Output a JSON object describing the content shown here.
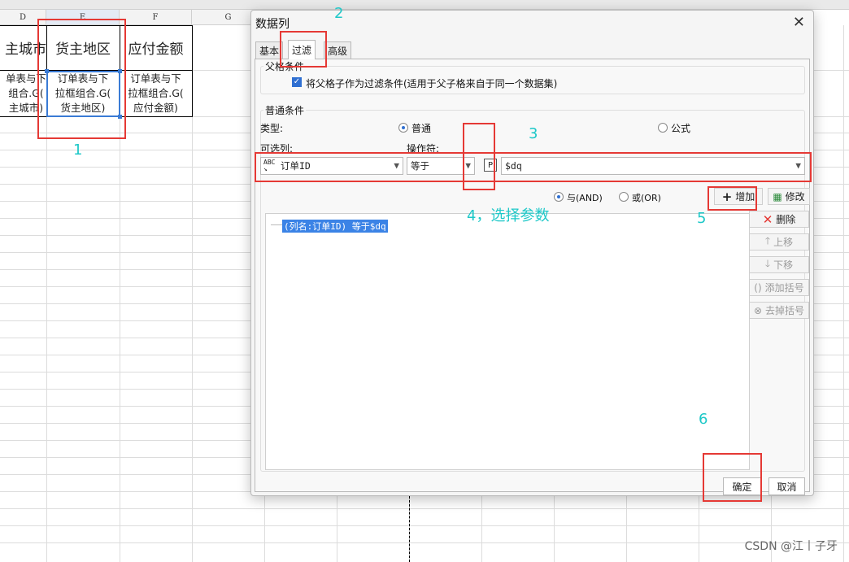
{
  "sheet": {
    "columns": [
      "D",
      "E",
      "F",
      "G"
    ],
    "headers": [
      "主城市",
      "货主地区",
      "应付金额"
    ],
    "cells": [
      "单表与下\n组合.G(\n主城市)",
      "订单表与下\n拉框组合.G(\n货主地区)",
      "订单表与下\n拉框组合.G(\n应付金额)"
    ]
  },
  "dialog": {
    "title": "数据列",
    "close": "✕",
    "tabs": [
      "基本",
      "过滤",
      "高级"
    ],
    "parent_group_title": "父格条件",
    "parent_checkbox_label": "将父格子作为过滤条件(适用于父子格来自于同一个数据集)",
    "normal_group_title": "普通条件",
    "type_label": "类型:",
    "type_options": [
      "普通",
      "公式"
    ],
    "column_label": "可选列:",
    "operator_label": "操作符:",
    "column_value": "订单ID",
    "operator_value": "等于",
    "param_button": "P",
    "param_value": "$dq",
    "logic_options": [
      "与(AND)",
      "或(OR)"
    ],
    "conditions": [
      "(列名:订单ID) 等于$dq"
    ],
    "side_buttons": {
      "add": "增加",
      "modify": "修改",
      "delete": "删除",
      "up": "上移",
      "down": "下移",
      "add_bracket": "添加括号",
      "remove_bracket": "去掉括号"
    },
    "ok": "确定",
    "cancel": "取消"
  },
  "annotations": [
    "1",
    "2",
    "3",
    "4，选择参数",
    "5",
    "6"
  ],
  "watermark": "CSDN @江丨子牙",
  "colors": {
    "annotation_box": "#e53935",
    "annotation_text": "#1ec8c8",
    "selection": "#3a7bd5"
  }
}
